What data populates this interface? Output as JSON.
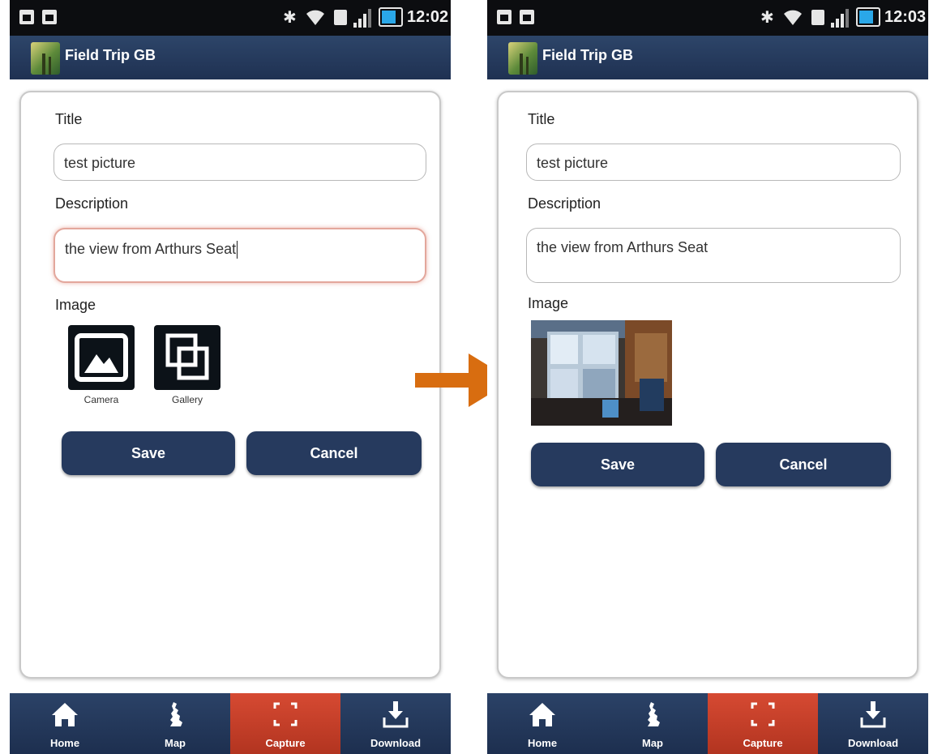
{
  "app": {
    "title": "Field Trip GB"
  },
  "left": {
    "status": {
      "time": "12:02"
    },
    "form": {
      "title_label": "Title",
      "title_value": "test picture",
      "description_label": "Description",
      "description_value": "the view from Arthurs Seat",
      "image_label": "Image",
      "camera_label": "Camera",
      "gallery_label": "Gallery",
      "save_label": "Save",
      "cancel_label": "Cancel"
    }
  },
  "right": {
    "status": {
      "time": "12:03"
    },
    "form": {
      "title_label": "Title",
      "title_value": "test picture",
      "description_label": "Description",
      "description_value": "the view from Arthurs Seat",
      "image_label": "Image",
      "save_label": "Save",
      "cancel_label": "Cancel"
    }
  },
  "tabs": [
    {
      "label": "Home",
      "icon": "home-icon"
    },
    {
      "label": "Map",
      "icon": "map-icon"
    },
    {
      "label": "Capture",
      "icon": "capture-icon",
      "active": true
    },
    {
      "label": "Download",
      "icon": "download-icon"
    }
  ],
  "colors": {
    "nav": "#263a5e",
    "active_tab": "#c73d28",
    "arrow": "#d86d10"
  }
}
